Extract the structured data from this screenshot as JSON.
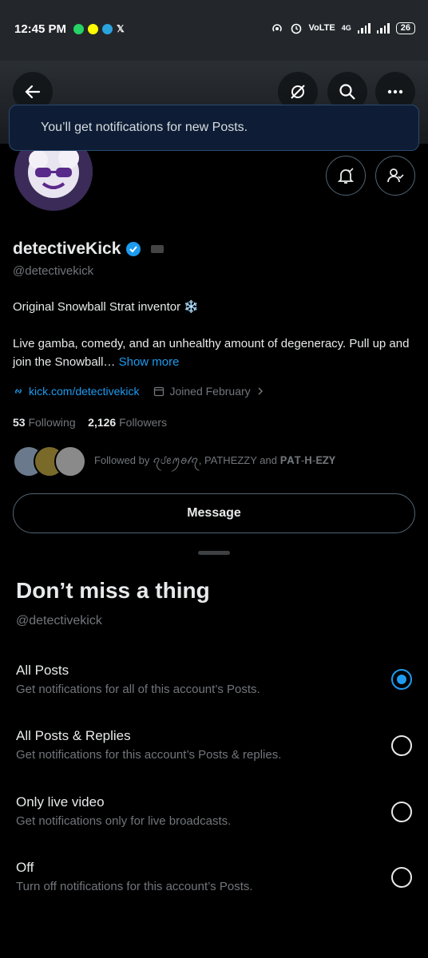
{
  "status_bar": {
    "time": "12:45 PM",
    "network": "VoLTE",
    "network_gen": "4G",
    "battery": "26",
    "app_icons": [
      "whatsapp-icon",
      "snapchat-icon",
      "telegram-icon",
      "x-icon"
    ]
  },
  "toast": {
    "text": "You’ll get notifications for new Posts."
  },
  "profile": {
    "name": "detectiveKick",
    "handle": "@detectivekick",
    "bio_line1": "Original Snowball Strat inventor ❄️",
    "bio_line2": "Live gamba, comedy, and an unhealthy amount of degeneracy. Pull up and join the Snowball…",
    "show_more": "Show more",
    "link": "kick.com/detectivekick",
    "joined": "Joined February",
    "following_count": "53",
    "following_label": "Following",
    "followers_count": "2,126",
    "followers_label": "Followers",
    "followed_by": "Followed by ꪖᦔꫀꪑꪮ𝓁ꪖ, PATHEZZY and 𝐏𝐀𝐓-𝐇-𝐄𝐙𝐘",
    "message_button": "Message"
  },
  "sheet": {
    "title": "Don’t miss a thing",
    "handle": "@detectivekick",
    "options": [
      {
        "title": "All Posts",
        "subtitle": "Get notifications for all of this account’s Posts.",
        "selected": true
      },
      {
        "title": "All Posts & Replies",
        "subtitle": "Get notifications for this account’s Posts & replies.",
        "selected": false
      },
      {
        "title": "Only live video",
        "subtitle": "Get notifications only for live broadcasts.",
        "selected": false
      },
      {
        "title": "Off",
        "subtitle": "Turn off notifications for this account’s Posts.",
        "selected": false
      }
    ]
  },
  "colors": {
    "accent": "#1d9bf0",
    "toast_bg": "#0e1d35",
    "text_primary": "#e7e9ea",
    "text_secondary": "#71767b"
  }
}
